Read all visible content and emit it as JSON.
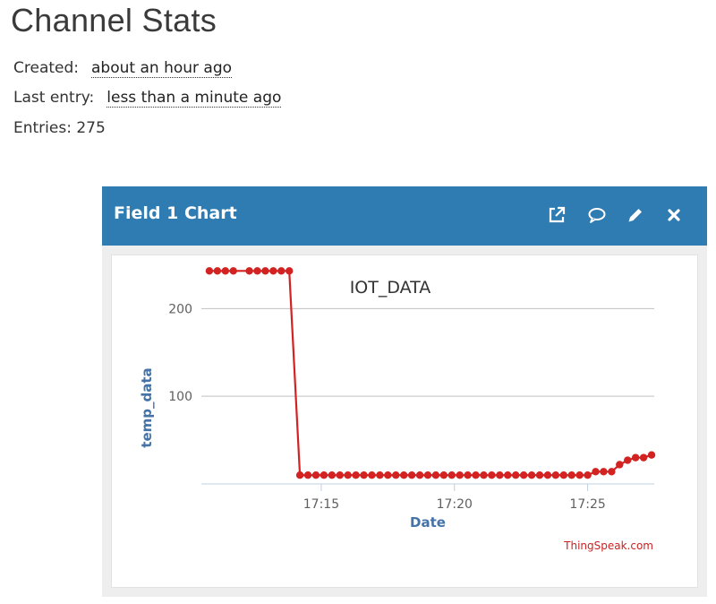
{
  "page": {
    "title": "Channel Stats"
  },
  "stats": {
    "created_label": "Created:",
    "created_value": "about an hour ago",
    "last_entry_label": "Last entry:",
    "last_entry_value": "less than a minute ago",
    "entries_text": "Entries: 275"
  },
  "panel": {
    "title": "Field 1 Chart",
    "icons": [
      "external-link-icon",
      "comment-icon",
      "pencil-icon",
      "close-icon"
    ]
  },
  "colors": {
    "header": "#2f7cb2",
    "series": "#d22222",
    "axis_label": "#4572a7"
  },
  "chart_data": {
    "type": "line",
    "title": "IOT_DATA",
    "xlabel": "Date",
    "ylabel": "temp_data",
    "credit": "ThingSpeak.com",
    "x_ticks": [
      "17:15",
      "17:20",
      "17:25"
    ],
    "y_ticks": [
      100,
      200
    ],
    "grid": true,
    "x_format": "minutes after 17:00",
    "xlim": [
      10.5,
      27.5
    ],
    "ylim": [
      0,
      230
    ],
    "series": [
      {
        "values": [
          [
            10.8,
            243
          ],
          [
            11.1,
            243
          ],
          [
            11.4,
            243
          ],
          [
            11.7,
            243
          ],
          [
            12.3,
            243
          ],
          [
            12.6,
            243
          ],
          [
            12.9,
            243
          ],
          [
            13.2,
            243
          ],
          [
            13.5,
            243
          ],
          [
            13.8,
            243
          ],
          [
            14.2,
            10
          ],
          [
            14.5,
            10
          ],
          [
            14.8,
            10
          ],
          [
            15.1,
            10
          ],
          [
            15.4,
            10
          ],
          [
            15.7,
            10
          ],
          [
            16.0,
            10
          ],
          [
            16.3,
            10
          ],
          [
            16.6,
            10
          ],
          [
            16.9,
            10
          ],
          [
            17.2,
            10
          ],
          [
            17.5,
            10
          ],
          [
            17.8,
            10
          ],
          [
            18.1,
            10
          ],
          [
            18.4,
            10
          ],
          [
            18.7,
            10
          ],
          [
            19.0,
            10
          ],
          [
            19.3,
            10
          ],
          [
            19.6,
            10
          ],
          [
            19.9,
            10
          ],
          [
            20.2,
            10
          ],
          [
            20.5,
            10
          ],
          [
            20.8,
            10
          ],
          [
            21.1,
            10
          ],
          [
            21.4,
            10
          ],
          [
            21.7,
            10
          ],
          [
            22.0,
            10
          ],
          [
            22.3,
            10
          ],
          [
            22.6,
            10
          ],
          [
            22.9,
            10
          ],
          [
            23.2,
            10
          ],
          [
            23.5,
            10
          ],
          [
            23.8,
            10
          ],
          [
            24.1,
            10
          ],
          [
            24.4,
            10
          ],
          [
            24.7,
            10
          ],
          [
            25.0,
            10
          ],
          [
            25.3,
            14
          ],
          [
            25.6,
            14
          ],
          [
            25.9,
            14
          ],
          [
            26.2,
            22
          ],
          [
            26.5,
            27
          ],
          [
            26.8,
            30
          ],
          [
            27.1,
            30
          ],
          [
            27.4,
            33
          ]
        ]
      }
    ]
  }
}
